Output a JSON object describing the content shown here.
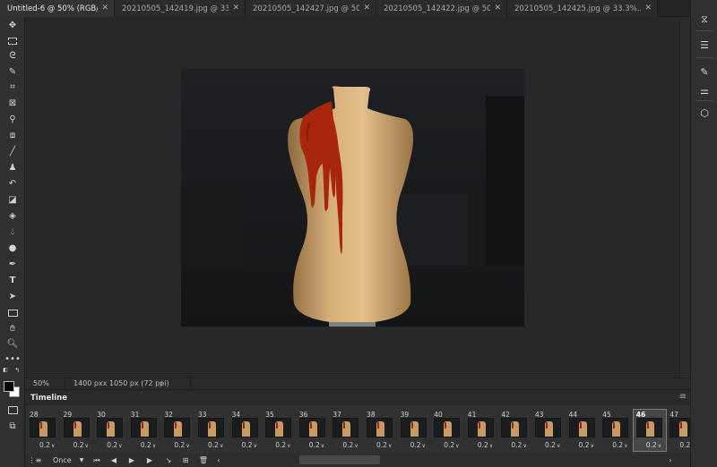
{
  "tabs": [
    {
      "label": "Untitled-6 @ 50% (RGB/8#) *",
      "active": true
    },
    {
      "label": "20210505_142419.jpg @ 33.3%...",
      "active": false
    },
    {
      "label": "20210505_142427.jpg @ 50% (L...",
      "active": false
    },
    {
      "label": "20210505_142422.jpg @ 50% (L...",
      "active": false
    },
    {
      "label": "20210505_142425.jpg @ 33.3%...",
      "active": false
    }
  ],
  "status": {
    "zoom": "50%",
    "doc_info": "1400 pxx 1050 px (72 ppi)"
  },
  "timeline": {
    "title": "Timeline",
    "loop": "Once",
    "selected_frame": "46",
    "frames": [
      {
        "num": "28",
        "delay": "0.2"
      },
      {
        "num": "29",
        "delay": "0.2"
      },
      {
        "num": "30",
        "delay": "0.2"
      },
      {
        "num": "31",
        "delay": "0.2"
      },
      {
        "num": "32",
        "delay": "0.2"
      },
      {
        "num": "33",
        "delay": "0.2"
      },
      {
        "num": "34",
        "delay": "0.2"
      },
      {
        "num": "35",
        "delay": "0.2"
      },
      {
        "num": "36",
        "delay": "0.2"
      },
      {
        "num": "37",
        "delay": "0.2"
      },
      {
        "num": "38",
        "delay": "0.2"
      },
      {
        "num": "39",
        "delay": "0.2"
      },
      {
        "num": "40",
        "delay": "0.2"
      },
      {
        "num": "41",
        "delay": "0.2"
      },
      {
        "num": "42",
        "delay": "0.2"
      },
      {
        "num": "43",
        "delay": "0.2"
      },
      {
        "num": "44",
        "delay": "0.2"
      },
      {
        "num": "45",
        "delay": "0.2"
      },
      {
        "num": "46",
        "delay": "0.2"
      },
      {
        "num": "47",
        "delay": "0.2"
      }
    ]
  },
  "tools_left": [
    "move-icon",
    "marquee-icon",
    "lasso-icon",
    "quick-select-icon",
    "crop-icon",
    "frame-icon",
    "eyedropper-icon",
    "healing-brush-icon",
    "brush-icon",
    "clone-stamp-icon",
    "history-brush-icon",
    "eraser-icon",
    "paint-bucket-icon",
    "blur-icon",
    "dodge-icon",
    "pen-icon",
    "type-icon",
    "path-select-icon",
    "rectangle-icon",
    "hand-icon",
    "zoom-icon",
    "more-tools-icon"
  ],
  "tools_right": [
    "history-panel-icon",
    "adjustments-panel-icon",
    "brush-settings-icon",
    "properties-panel-icon",
    "3d-panel-icon"
  ]
}
